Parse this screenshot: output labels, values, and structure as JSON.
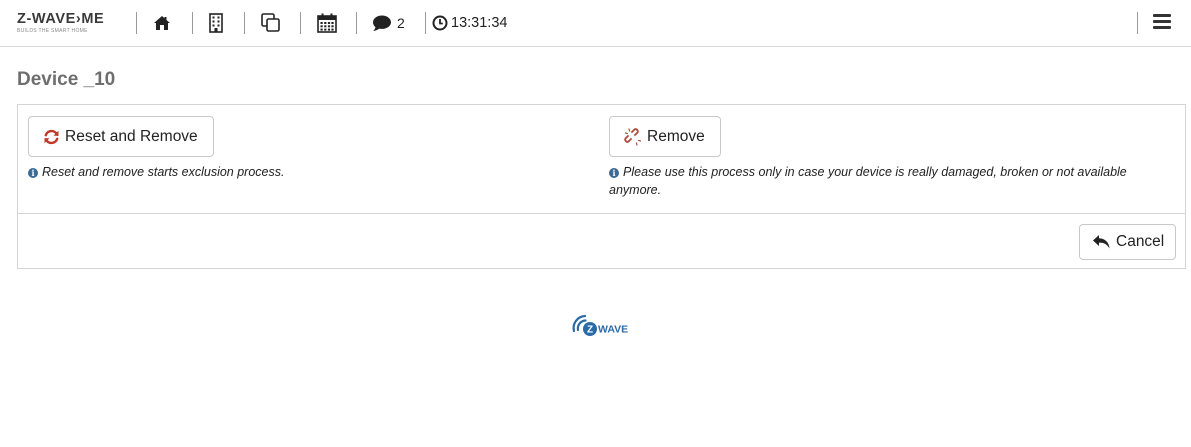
{
  "header": {
    "logo_text": "Z-WAVE›ME",
    "logo_tagline": "BUILDS THE SMART HOME",
    "messages_count": "2",
    "clock": "13:31:34",
    "icons": [
      "home-icon",
      "building-icon",
      "copy-icon",
      "calendar-icon",
      "comment-icon",
      "clock-icon",
      "hamburger-menu-icon"
    ]
  },
  "page": {
    "title": "Device _10"
  },
  "actions": {
    "reset_label": "Reset and Remove",
    "reset_hint": "Reset and remove starts exclusion process.",
    "remove_label": "Remove",
    "remove_hint": "Please use this process only in case your device is really damaged, broken or not available anymore.",
    "cancel_label": "Cancel"
  },
  "footer": {
    "logo_text": "WAVE",
    "logo_letter": "Z"
  },
  "colors": {
    "reset_icon": "#c0392b",
    "remove_icon": "#b05040",
    "info_icon": "#3b6b94",
    "zwave_blue": "#2a6aa6"
  }
}
